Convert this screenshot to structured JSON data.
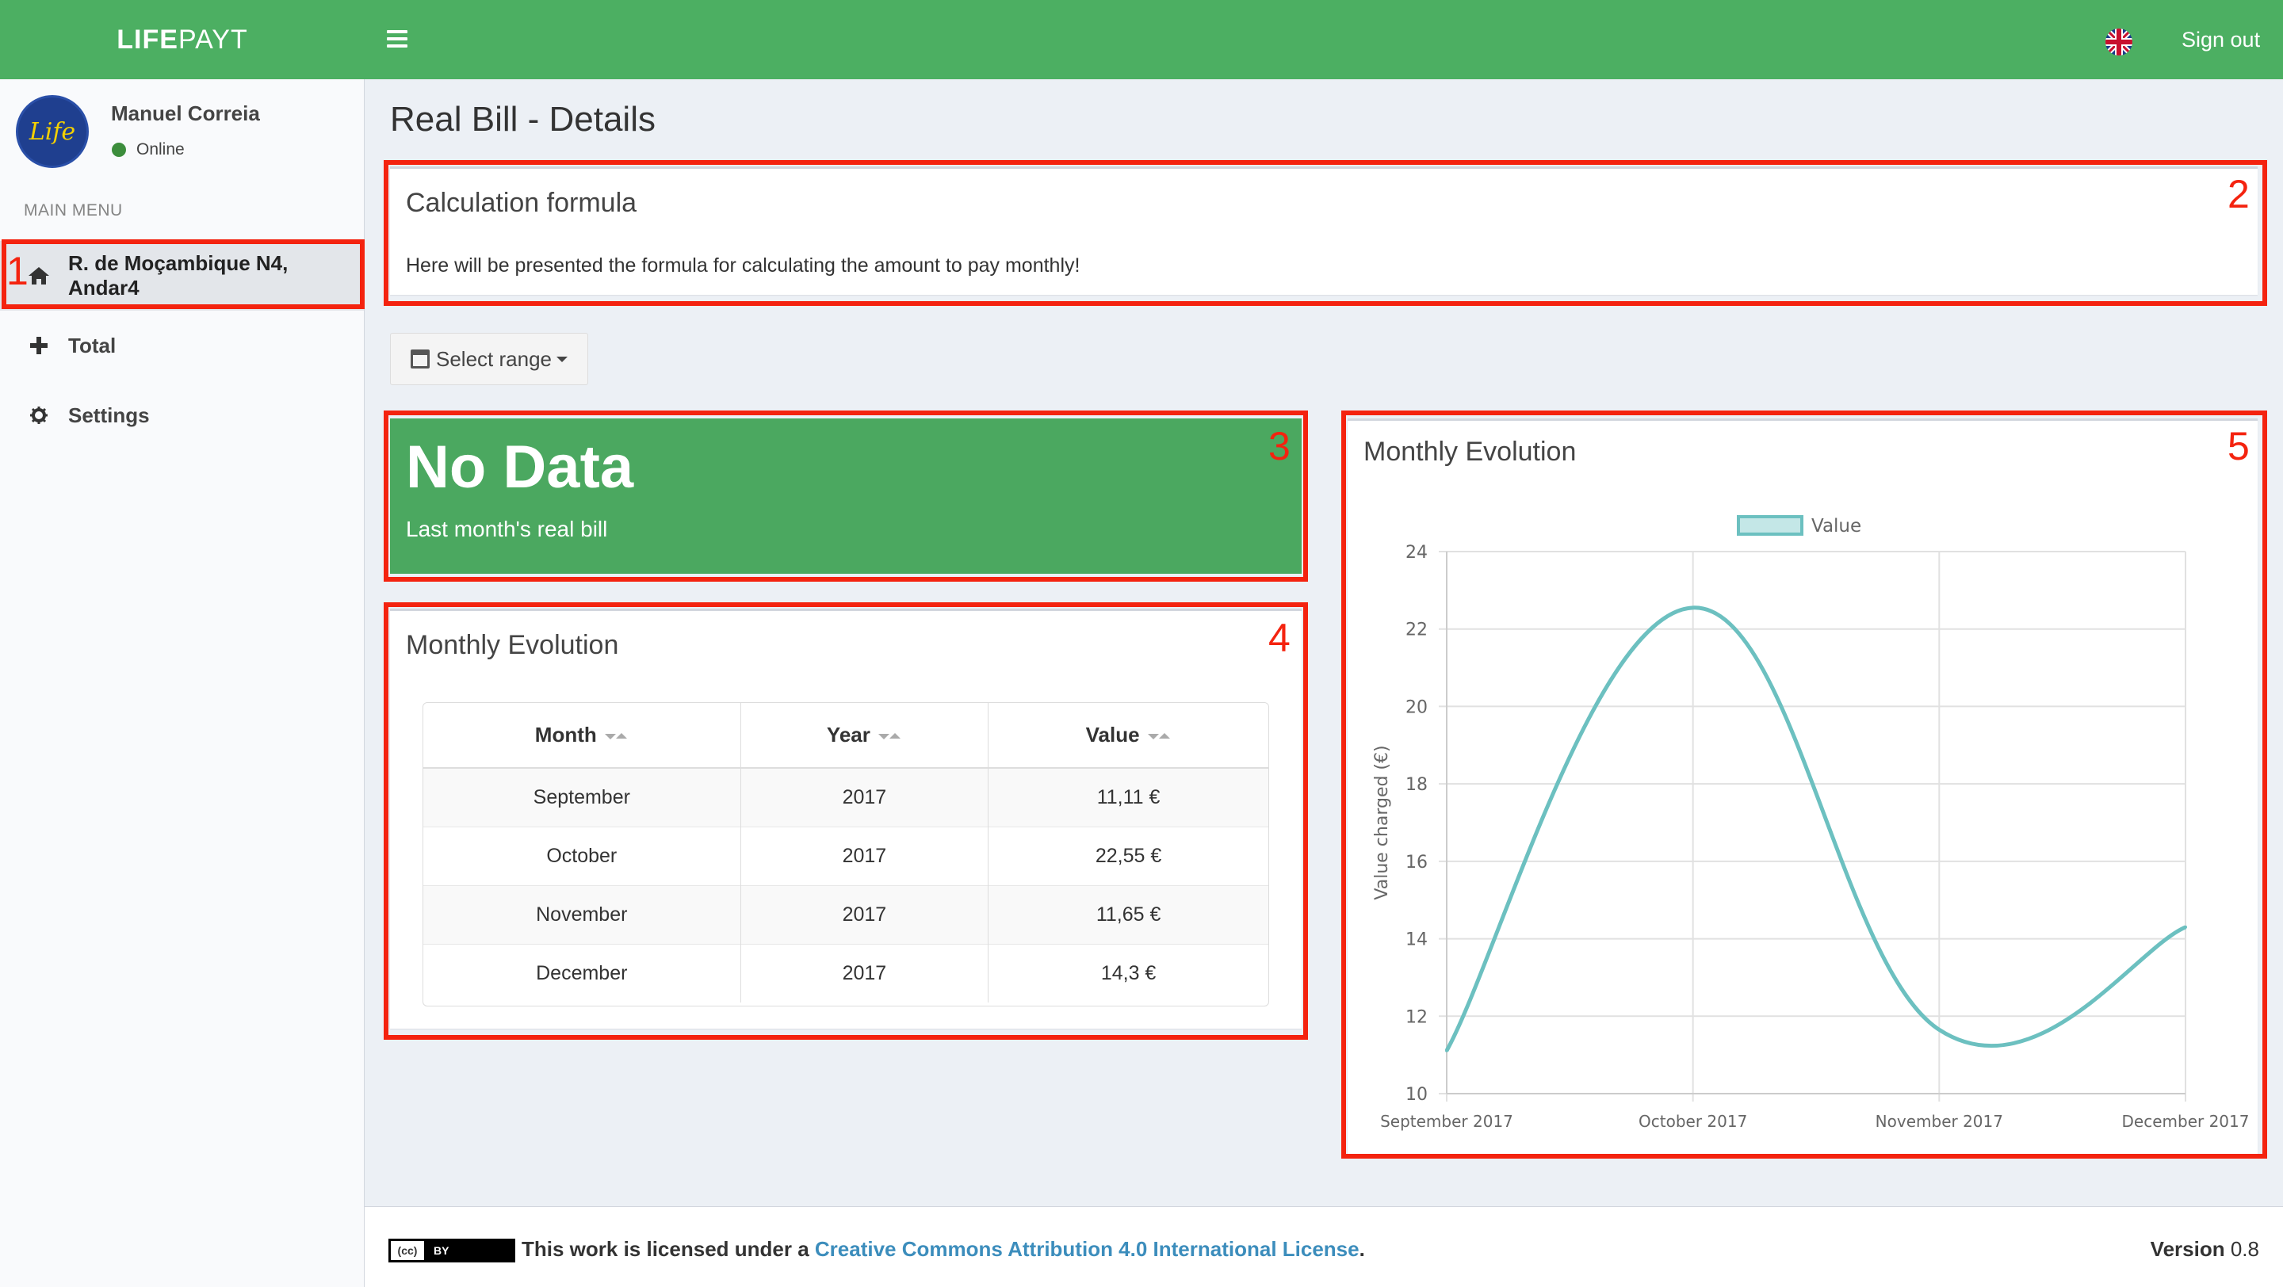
{
  "header": {
    "logo_bold": "LIFE",
    "logo_light": "PAYT",
    "sign_out_label": "Sign out",
    "language_flag": "uk-flag-icon",
    "brand_color": "#4caf62"
  },
  "sidebar": {
    "user_name": "Manuel Correia",
    "user_status": "Online",
    "avatar_text": "Life",
    "menu_header": "MAIN MENU",
    "items": [
      {
        "label": "R. de Moçambique N4, Andar4",
        "icon": "home-icon",
        "active": true
      },
      {
        "label": "Total",
        "icon": "plus-icon",
        "active": false
      },
      {
        "label": "Settings",
        "icon": "gear-icon",
        "active": false
      }
    ]
  },
  "main": {
    "page_title": "Real Bill - Details",
    "formula_box": {
      "title": "Calculation formula",
      "text": "Here will be presented the formula for calculating the amount to pay monthly!"
    },
    "range_button_label": "Select range",
    "summary_box": {
      "value": "No Data",
      "label": "Last month's real bill",
      "color": "#4ba860"
    },
    "table_box": {
      "title": "Monthly Evolution",
      "columns": [
        "Month",
        "Year",
        "Value"
      ],
      "rows": [
        [
          "September",
          "2017",
          "11,11 €"
        ],
        [
          "October",
          "2017",
          "22,55 €"
        ],
        [
          "November",
          "2017",
          "11,65 €"
        ],
        [
          "December",
          "2017",
          "14,3 €"
        ]
      ]
    },
    "chart_box": {
      "title": "Monthly Evolution"
    }
  },
  "chart_data": {
    "type": "line",
    "title": "",
    "xlabel": "",
    "ylabel": "Value charged (€)",
    "categories": [
      "September 2017",
      "October 2017",
      "November 2017",
      "December 2017"
    ],
    "series": [
      {
        "name": "Value",
        "values": [
          11.11,
          22.55,
          11.65,
          14.3
        ],
        "color": "#6cc0c0"
      }
    ],
    "ylim": [
      10,
      24
    ],
    "yticks": [
      10,
      12,
      14,
      16,
      18,
      20,
      22,
      24
    ],
    "grid": true,
    "legend": "top"
  },
  "annotations": [
    "1",
    "2",
    "3",
    "4",
    "5"
  ],
  "annotation_color": "#f4230f",
  "footer": {
    "license_prefix": "This work is licensed under a ",
    "license_link": "Creative Commons Attribution 4.0 International License",
    "license_suffix": ".",
    "cc_badge_cc": "(cc)",
    "cc_badge_by": "BY",
    "version_label": "Version",
    "version_value": "0.8"
  }
}
